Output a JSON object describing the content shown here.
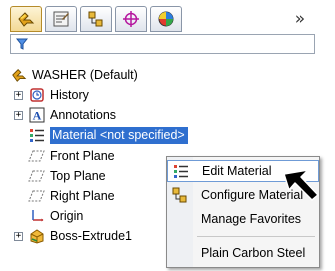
{
  "toolbar": {
    "tabs": [
      {
        "icon": "feature-manager-icon"
      },
      {
        "icon": "property-manager-icon"
      },
      {
        "icon": "configuration-manager-icon"
      },
      {
        "icon": "dimxpert-manager-icon"
      },
      {
        "icon": "display-manager-icon"
      }
    ],
    "more_label": "»"
  },
  "filter": {
    "icon": "filter-icon"
  },
  "tree": {
    "root_label": "WASHER  (Default)",
    "items": [
      {
        "label": "History",
        "icon": "history-icon"
      },
      {
        "label": "Annotations",
        "icon": "annotations-icon"
      },
      {
        "label": "Material <not specified>",
        "icon": "material-icon"
      },
      {
        "label": "Front Plane",
        "icon": "plane-icon"
      },
      {
        "label": "Top Plane",
        "icon": "plane-icon"
      },
      {
        "label": "Right Plane",
        "icon": "plane-icon"
      },
      {
        "label": "Origin",
        "icon": "origin-icon"
      },
      {
        "label": "Boss-Extrude1",
        "icon": "boss-extrude-icon"
      }
    ]
  },
  "context_menu": {
    "items": [
      {
        "label": "Edit Material",
        "icon": "edit-material-icon"
      },
      {
        "label": "Configure Material",
        "icon": "configure-material-icon"
      },
      {
        "label": "Manage Favorites"
      },
      {
        "label": "Plain Carbon Steel"
      }
    ]
  },
  "colors": {
    "selection": "#2f6fcf",
    "active_tab": "#f3d995"
  }
}
